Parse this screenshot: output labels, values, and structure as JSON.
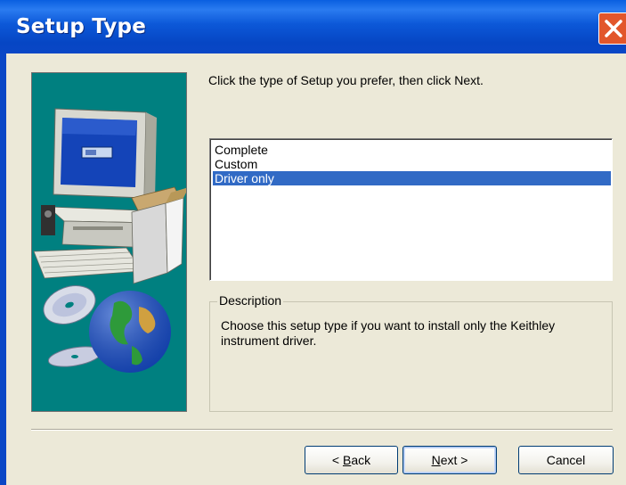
{
  "window": {
    "title": "Setup Type",
    "close_icon": "close-x-icon"
  },
  "main": {
    "instruction": "Click the type of Setup you prefer, then click Next.",
    "setup_types": [
      {
        "label": "Complete",
        "selected": false
      },
      {
        "label": "Custom",
        "selected": false
      },
      {
        "label": "Driver only",
        "selected": true
      }
    ],
    "description": {
      "label": "Description",
      "text": "Choose this setup type if you want to install only the Keithley instrument driver."
    }
  },
  "buttons": {
    "back_prefix": "< ",
    "back_mnemonic": "B",
    "back_rest": "ack",
    "next_mnemonic": "N",
    "next_rest": "ext >",
    "cancel": "Cancel"
  },
  "colors": {
    "titlebar": "#0a47c6",
    "close": "#e2562b",
    "side_panel": "#008080",
    "selection": "#316ac5",
    "dialog_bg": "#ece9d8"
  }
}
